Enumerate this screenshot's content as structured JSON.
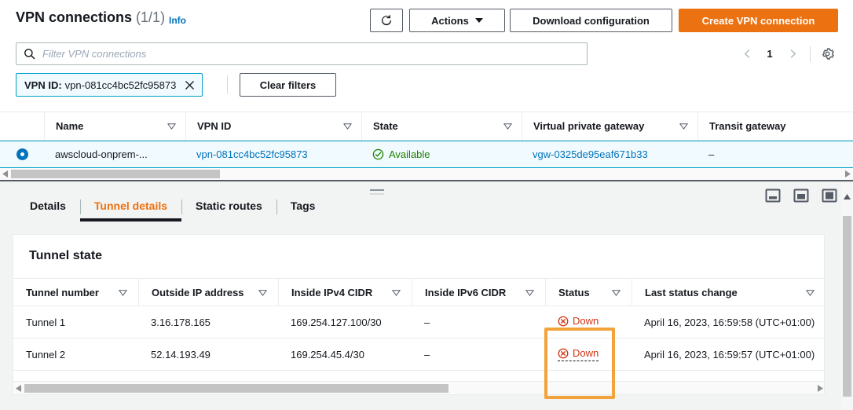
{
  "header": {
    "title": "VPN connections",
    "count": "(1/1)",
    "info_link": "Info",
    "refresh_icon": "refresh-icon",
    "actions_button": "Actions",
    "download_button": "Download configuration",
    "create_button": "Create VPN connection"
  },
  "search": {
    "placeholder": "Filter VPN connections",
    "value": "",
    "icon": "search-icon"
  },
  "pagination": {
    "prev_icon": "chevron-left-icon",
    "page": "1",
    "next_icon": "chevron-right-icon",
    "settings_icon": "gear-icon"
  },
  "filters": {
    "token_key": "VPN ID:",
    "token_value": "vpn-081cc4bc52fc95873",
    "token_remove_icon": "close-icon",
    "clear_button": "Clear filters"
  },
  "table": {
    "columns": [
      {
        "label": "Name",
        "sortable": true
      },
      {
        "label": "VPN ID",
        "sortable": true
      },
      {
        "label": "State",
        "sortable": true
      },
      {
        "label": "Virtual private gateway",
        "sortable": true
      },
      {
        "label": "Transit gateway",
        "sortable": false
      }
    ],
    "rows": [
      {
        "selected": true,
        "name": "awscloud-onprem-...",
        "vpn_id": "vpn-081cc4bc52fc95873",
        "state": "Available",
        "state_icon": "check-circle-icon",
        "virtual_private_gateway": "vgw-0325de95eaf671b33",
        "transit_gateway": "–"
      }
    ]
  },
  "split_panel": {
    "drag_handle": "resize-handle",
    "size_buttons": [
      "panel-size-small-icon",
      "panel-size-medium-icon",
      "panel-size-large-icon"
    ],
    "tabs": [
      {
        "label": "Details",
        "active": false
      },
      {
        "label": "Tunnel details",
        "active": true
      },
      {
        "label": "Static routes",
        "active": false
      },
      {
        "label": "Tags",
        "active": false
      }
    ],
    "card_title": "Tunnel state",
    "tunnel_columns": [
      {
        "label": "Tunnel number",
        "sortable": true
      },
      {
        "label": "Outside IP address",
        "sortable": true
      },
      {
        "label": "Inside IPv4 CIDR",
        "sortable": true
      },
      {
        "label": "Inside IPv6 CIDR",
        "sortable": true
      },
      {
        "label": "Status",
        "sortable": true
      },
      {
        "label": "Last status change",
        "sortable": true
      }
    ],
    "tunnels": [
      {
        "number": "Tunnel 1",
        "outside_ip": "3.16.178.165",
        "inside_ipv4": "169.254.127.100/30",
        "inside_ipv6": "–",
        "status": "Down",
        "status_icon": "error-circle-icon",
        "last_change": "April 16, 2023, 16:59:58 (UTC+01:00)"
      },
      {
        "number": "Tunnel 2",
        "outside_ip": "52.14.193.49",
        "inside_ipv4": "169.254.45.4/30",
        "inside_ipv6": "–",
        "status": "Down",
        "status_icon": "error-circle-icon",
        "last_change": "April 16, 2023, 16:59:57 (UTC+01:00)"
      }
    ]
  },
  "colors": {
    "accent_orange": "#ec7211",
    "link_blue": "#0073bb",
    "selection_border": "#00a1c9",
    "status_down_red": "#d13212",
    "status_ok_green": "#1d8102",
    "annotation_orange": "#f2a33c"
  }
}
